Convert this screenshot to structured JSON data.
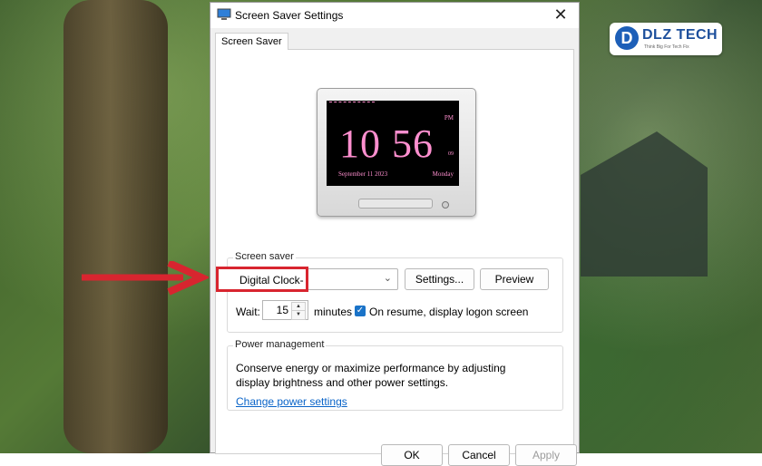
{
  "dialog": {
    "title": "Screen Saver Settings",
    "close_glyph": "✕",
    "tab": "Screen Saver"
  },
  "preview": {
    "time": "10 56",
    "ampm": "PM",
    "seconds": "09",
    "date": "September 11 2023",
    "day": "Monday"
  },
  "screen_saver": {
    "group_label": "Screen saver",
    "selected": "Digital Clock-",
    "settings_label": "Settings...",
    "preview_label": "Preview",
    "wait_label": "Wait:",
    "wait_value": "15",
    "minutes_label": "minutes",
    "resume_checked": true,
    "resume_label": "On resume, display logon screen"
  },
  "power": {
    "group_label": "Power management",
    "description": "Conserve energy or maximize performance by adjusting display brightness and other power settings.",
    "link": "Change power settings"
  },
  "footer": {
    "ok": "OK",
    "cancel": "Cancel",
    "apply": "Apply"
  },
  "logo": {
    "mark": "D",
    "name": "DLZ TECH",
    "tagline": "Think Big For Tech Fix"
  },
  "colors": {
    "highlight": "#d8252f",
    "clock_pink": "#ff8fcf",
    "link": "#0a64c8",
    "checkbox": "#1a73c8"
  }
}
